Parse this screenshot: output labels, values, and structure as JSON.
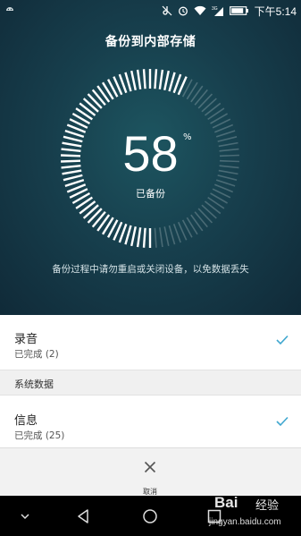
{
  "status_bar": {
    "time": "下午5:14",
    "icons": [
      "android-icon",
      "mute-icon",
      "alarm-icon",
      "wifi-icon",
      "signal-icon",
      "battery-icon"
    ],
    "network": "3G"
  },
  "hero": {
    "title": "备份到内部存储",
    "progress_percent": "58",
    "percent_sign": "%",
    "caption": "已备份",
    "note": "备份过程中请勿重启或关闭设备，以免数据丢失",
    "accent_color": "#ffffff"
  },
  "list": {
    "items": [
      {
        "title": "录音",
        "status": "已完成 (2)"
      },
      {
        "title": "信息",
        "status": "已完成 (25)"
      }
    ],
    "section_header": "系统数据",
    "check_color": "#3fa7cf"
  },
  "cancel": {
    "label": "取消"
  },
  "nav": {
    "buttons": [
      "collapse-icon",
      "back-icon",
      "home-icon",
      "recent-apps-icon"
    ]
  },
  "watermark": {
    "logo": "Bai",
    "brand": "经验",
    "url": "jingyan.baidu.com"
  }
}
